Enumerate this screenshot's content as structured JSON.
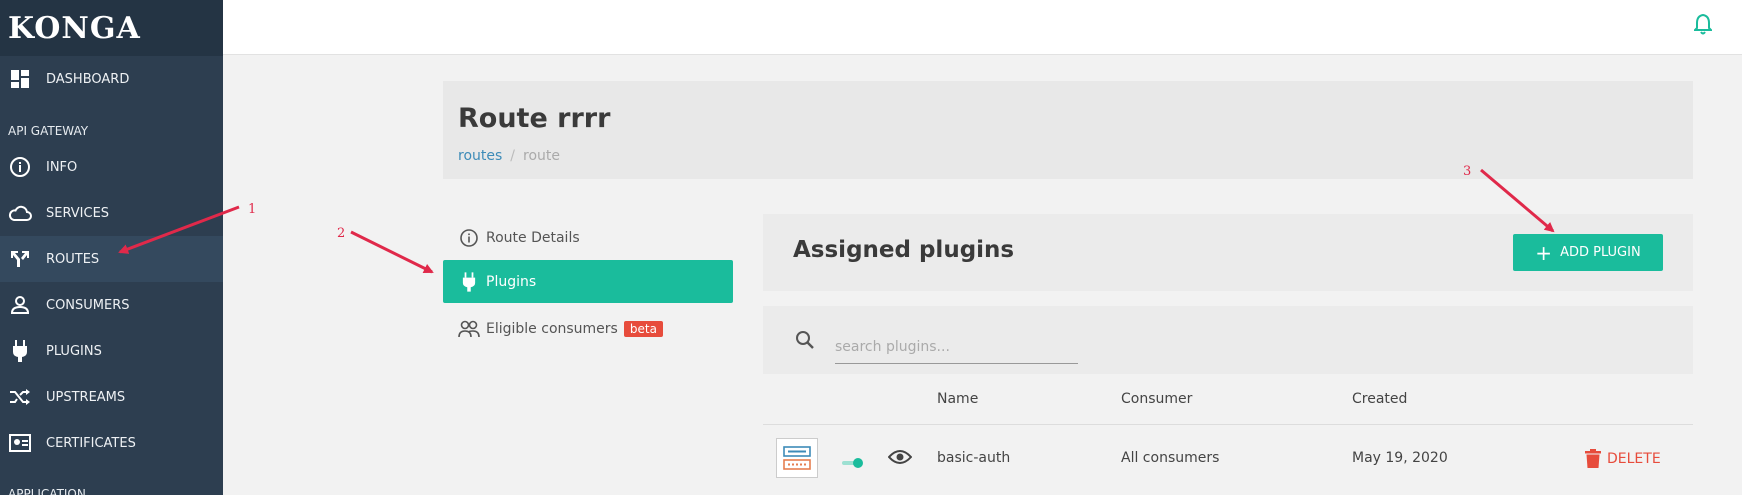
{
  "app": {
    "logo": "KONGA"
  },
  "sidebar": {
    "dashboard": "DASHBOARD",
    "section_api": "API GATEWAY",
    "items": [
      {
        "label": "INFO",
        "icon": "info-icon"
      },
      {
        "label": "SERVICES",
        "icon": "cloud-icon"
      },
      {
        "label": "ROUTES",
        "icon": "routes-icon",
        "active": true
      },
      {
        "label": "CONSUMERS",
        "icon": "user-icon"
      },
      {
        "label": "PLUGINS",
        "icon": "plug-icon"
      },
      {
        "label": "UPSTREAMS",
        "icon": "shuffle-icon"
      },
      {
        "label": "CERTIFICATES",
        "icon": "certificate-icon"
      }
    ],
    "section_app": "APPLICATION"
  },
  "page": {
    "title": "Route rrrr",
    "breadcrumb": {
      "link": "routes",
      "sep": "/",
      "current": "route"
    }
  },
  "tabs": {
    "details": "Route Details",
    "plugins": "Plugins",
    "consumers": "Eligible consumers",
    "beta": "beta"
  },
  "plugins": {
    "title": "Assigned plugins",
    "add_label": "ADD PLUGIN",
    "search_placeholder": "search plugins...",
    "columns": {
      "name": "Name",
      "consumer": "Consumer",
      "created": "Created"
    },
    "rows": [
      {
        "name": "basic-auth",
        "consumer": "All consumers",
        "created": "May 19, 2020",
        "delete": "DELETE"
      }
    ]
  },
  "annotations": [
    "1",
    "2",
    "3"
  ],
  "colors": {
    "accent": "#1abc9c",
    "sidebar": "#2d3e50",
    "danger": "#e74c3c",
    "annotation": "#e0294a"
  }
}
